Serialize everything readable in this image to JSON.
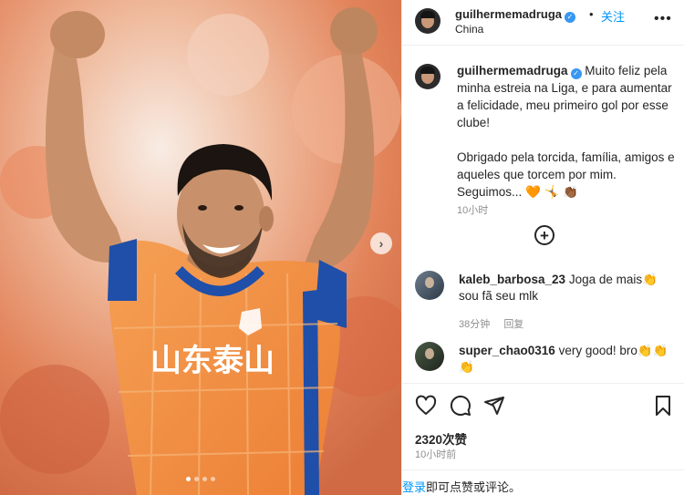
{
  "post": {
    "username": "guilhermemadruga",
    "separator": "•",
    "follow_label": "关注",
    "location": "China",
    "more_label": "•••",
    "photo_carousel": {
      "slide_count": 4,
      "active_slide": 1,
      "next_label": "›"
    }
  },
  "caption": {
    "username": "guilhermemadruga",
    "text_paragraph_1": "Muito feliz pela minha estreia na Liga, e para aumentar a felicidade, meu primeiro gol por esse clube!",
    "text_paragraph_2": "Obrigado pela torcida, família, amigos e aqueles que torcem por mim. Seguimos... 🧡 🤸 👏🏾",
    "time": "10小时"
  },
  "load_more": {
    "label": "+"
  },
  "comments": [
    {
      "username": "kaleb_barbosa_23",
      "text": "Joga de mais👏 sou fã seu mlk",
      "time": "38分钟",
      "reply_label": "回复"
    },
    {
      "username": "super_chao0316",
      "text": "very good!   bro👏👏👏"
    }
  ],
  "actions": {
    "likes": "2320次赞",
    "time_ago": "10小时前"
  },
  "login_bar": {
    "login_label": "登录",
    "rest_text": "即可点赞或评论。"
  },
  "jersey_text": "山东泰山",
  "colors": {
    "link_blue": "#0095f6",
    "verified_blue": "#3897f0",
    "jersey_orange": "#f08a3c",
    "jersey_blue": "#1f4fa8"
  },
  "icons": [
    "verified-badge-icon",
    "more-options-icon",
    "plus-circle-icon",
    "heart-icon",
    "comment-icon",
    "share-icon",
    "bookmark-icon",
    "carousel-next-icon"
  ]
}
